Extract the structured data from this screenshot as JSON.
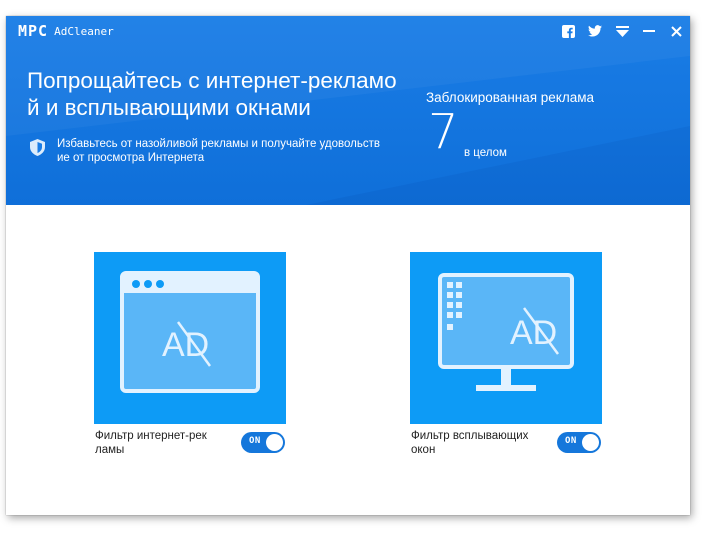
{
  "app": {
    "logo_mark": "MPC",
    "name": "AdCleaner"
  },
  "titlebar": {
    "icons": [
      "facebook-icon",
      "twitter-icon",
      "menu-icon",
      "minimize-icon",
      "close-icon"
    ]
  },
  "header": {
    "headline_line1": "Попрощайтесь с интернет-рекламо",
    "headline_line2": "й и всплывающими окнами",
    "subtitle_line1": "Избавьтесь от назойливой рекламы и получайте удовольств",
    "subtitle_line2": "ие от просмотра Интернета",
    "blocked_label": "Заблокированная реклама",
    "blocked_count": "7",
    "blocked_sub": "в целом"
  },
  "features": [
    {
      "label_line1": "Фильтр интернет-рек",
      "label_line2": "ламы",
      "toggle": "ON",
      "icon": "browser-ad-block-icon",
      "card_text": "AD"
    },
    {
      "label_line1": "Фильтр всплывающих",
      "label_line2": "окон",
      "toggle": "ON",
      "icon": "monitor-ad-block-icon",
      "card_text": "AD"
    }
  ],
  "colors": {
    "header_blue": "#1a7de6",
    "card_blue": "#0d9bf6",
    "toggle_blue": "#1577db"
  }
}
